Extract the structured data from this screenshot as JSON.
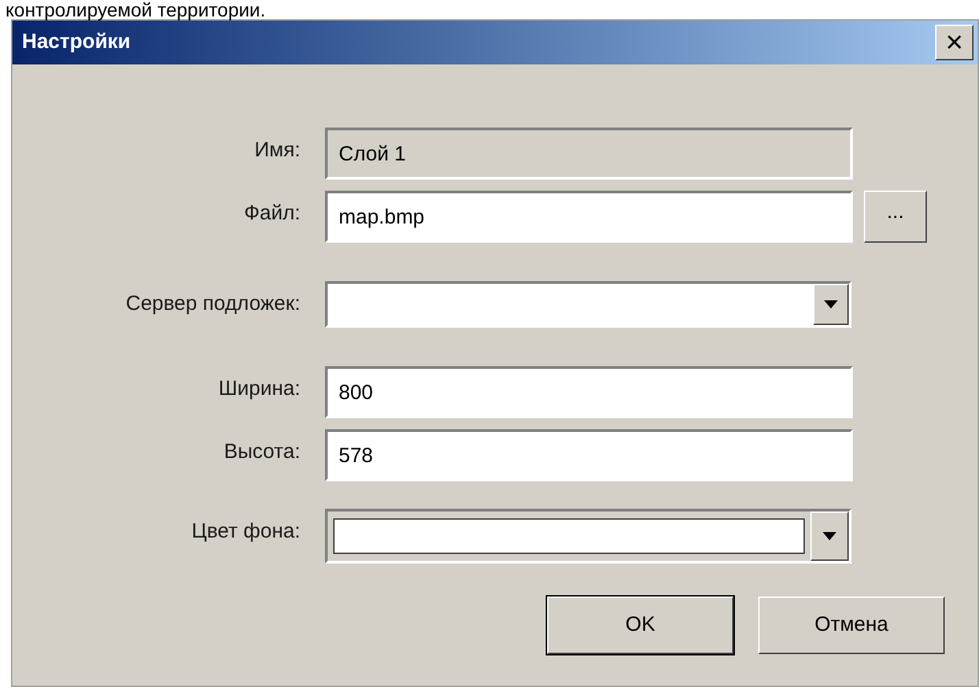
{
  "page_text": "контролируемой территории.",
  "window": {
    "title": "Настройки",
    "close": "×"
  },
  "fields": [
    {
      "kind": "text",
      "label": "Имя:",
      "value": "Слой 1",
      "disabled": true
    },
    {
      "kind": "file",
      "label": "Файл:",
      "value": "map.bmp",
      "disabled": false,
      "browse": "..."
    },
    {
      "kind": "dropdown",
      "label": "Сервер подложек:",
      "disabled": false
    },
    {
      "kind": "text",
      "label": "Ширина:",
      "value": "800",
      "disabled": false
    },
    {
      "kind": "text",
      "label": "Высота:",
      "value": "578",
      "disabled": false
    },
    {
      "kind": "color",
      "label": "Цвет фона:",
      "disabled": false
    }
  ],
  "buttons": [
    {
      "label": "OK",
      "default": true
    },
    {
      "label": "Отмена",
      "default": false
    }
  ]
}
